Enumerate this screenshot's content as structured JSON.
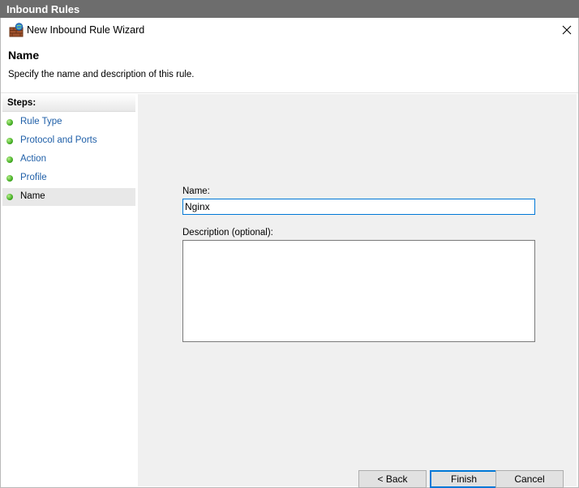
{
  "parent_window": {
    "title": "Inbound Rules"
  },
  "wizard": {
    "title": "New Inbound Rule Wizard",
    "page_title": "Name",
    "page_description": "Specify the name and description of this rule."
  },
  "steps": {
    "header": "Steps:",
    "items": [
      {
        "label": "Rule Type",
        "current": false
      },
      {
        "label": "Protocol and Ports",
        "current": false
      },
      {
        "label": "Action",
        "current": false
      },
      {
        "label": "Profile",
        "current": false
      },
      {
        "label": "Name",
        "current": true
      }
    ]
  },
  "form": {
    "name_label": "Name:",
    "name_value": "Nginx",
    "description_label": "Description (optional):",
    "description_value": ""
  },
  "buttons": {
    "back": "< Back",
    "finish": "Finish",
    "cancel": "Cancel"
  },
  "colors": {
    "step_link": "#1f5fa8",
    "focus_accent": "#0078d7",
    "top_bar": "#6d6d6d",
    "content_bg": "#f0f0f0"
  },
  "icons": {
    "title": "firewall-wizard-icon",
    "close": "close-icon",
    "step": "green-dot-icon"
  }
}
